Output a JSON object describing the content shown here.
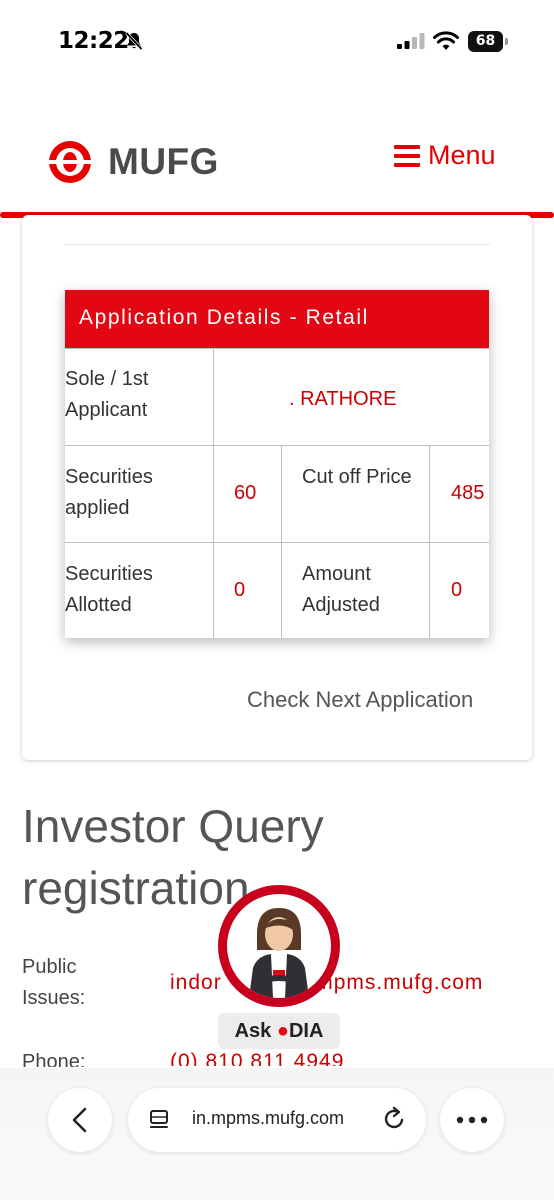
{
  "status_bar": {
    "time": "12:22",
    "battery": "68",
    "icons": [
      "bell-slash-icon",
      "cellular-signal-icon",
      "wifi-icon",
      "battery-icon"
    ]
  },
  "header": {
    "brand": "MUFG",
    "menu_label": "Menu",
    "accent_color": "#e60000"
  },
  "application_details": {
    "title": "Application Details - Retail",
    "applicant_label": "Sole / 1st Applicant",
    "applicant_name": ". RATHORE",
    "securities_applied_label": "Securities applied",
    "securities_applied_value": "60",
    "cut_off_price_label": "Cut off Price",
    "cut_off_price_value": "485",
    "securities_allotted_label": "Securities Allotted",
    "securities_allotted_value": "0",
    "amount_adjusted_label": "Amount Adjusted",
    "amount_adjusted_value": "0"
  },
  "check_next_label": "Check Next Application",
  "query_section": {
    "title": "Investor Query registration",
    "public_issues_label": "Public Issues:",
    "public_issues_value": "indor          in.mpms.mufg.com",
    "phone_label": "Phone:",
    "phone_value": "(0) 810 811 4949"
  },
  "assistant": {
    "label_prefix": "Ask ",
    "label_brand": "DIA",
    "badge": "DIA"
  },
  "browser": {
    "url": "in.mpms.mufg.com",
    "icons": [
      "chevron-left-icon",
      "tabs-icon",
      "reload-icon",
      "more-icon"
    ]
  }
}
